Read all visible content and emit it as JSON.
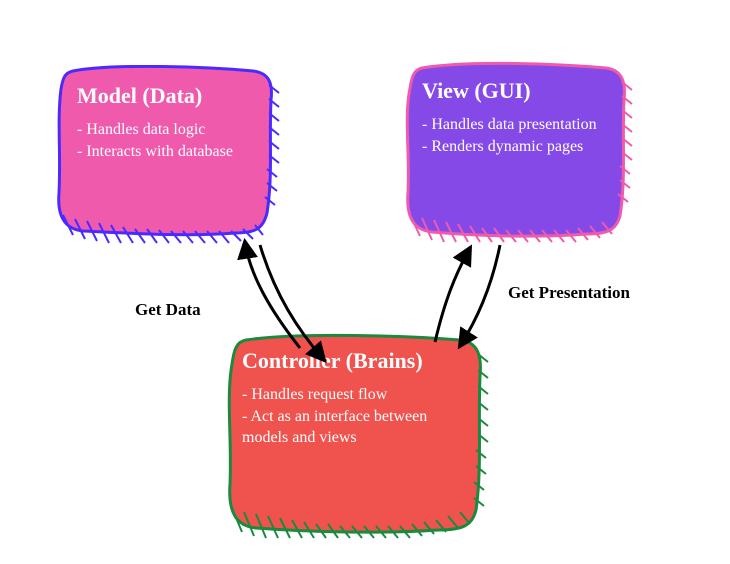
{
  "boxes": {
    "model": {
      "title": "Model (Data)",
      "bullets": [
        "- Handles data logic",
        "- Interacts with database"
      ]
    },
    "view": {
      "title": "View (GUI)",
      "bullets": [
        "- Handles data presentation",
        "- Renders dynamic pages"
      ]
    },
    "controller": {
      "title": "Controller (Brains)",
      "bullets": [
        "- Handles request flow",
        "- Act as an interface between models and views"
      ]
    }
  },
  "labels": {
    "get_data": "Get Data",
    "get_presentation": "Get Presentation"
  },
  "colors": {
    "model_fill": "#ef5aad",
    "model_stroke": "#4a2bff",
    "view_fill": "#8549e8",
    "view_stroke": "#ef5aad",
    "controller_fill": "#f0524d",
    "controller_stroke": "#1a8a3e"
  }
}
